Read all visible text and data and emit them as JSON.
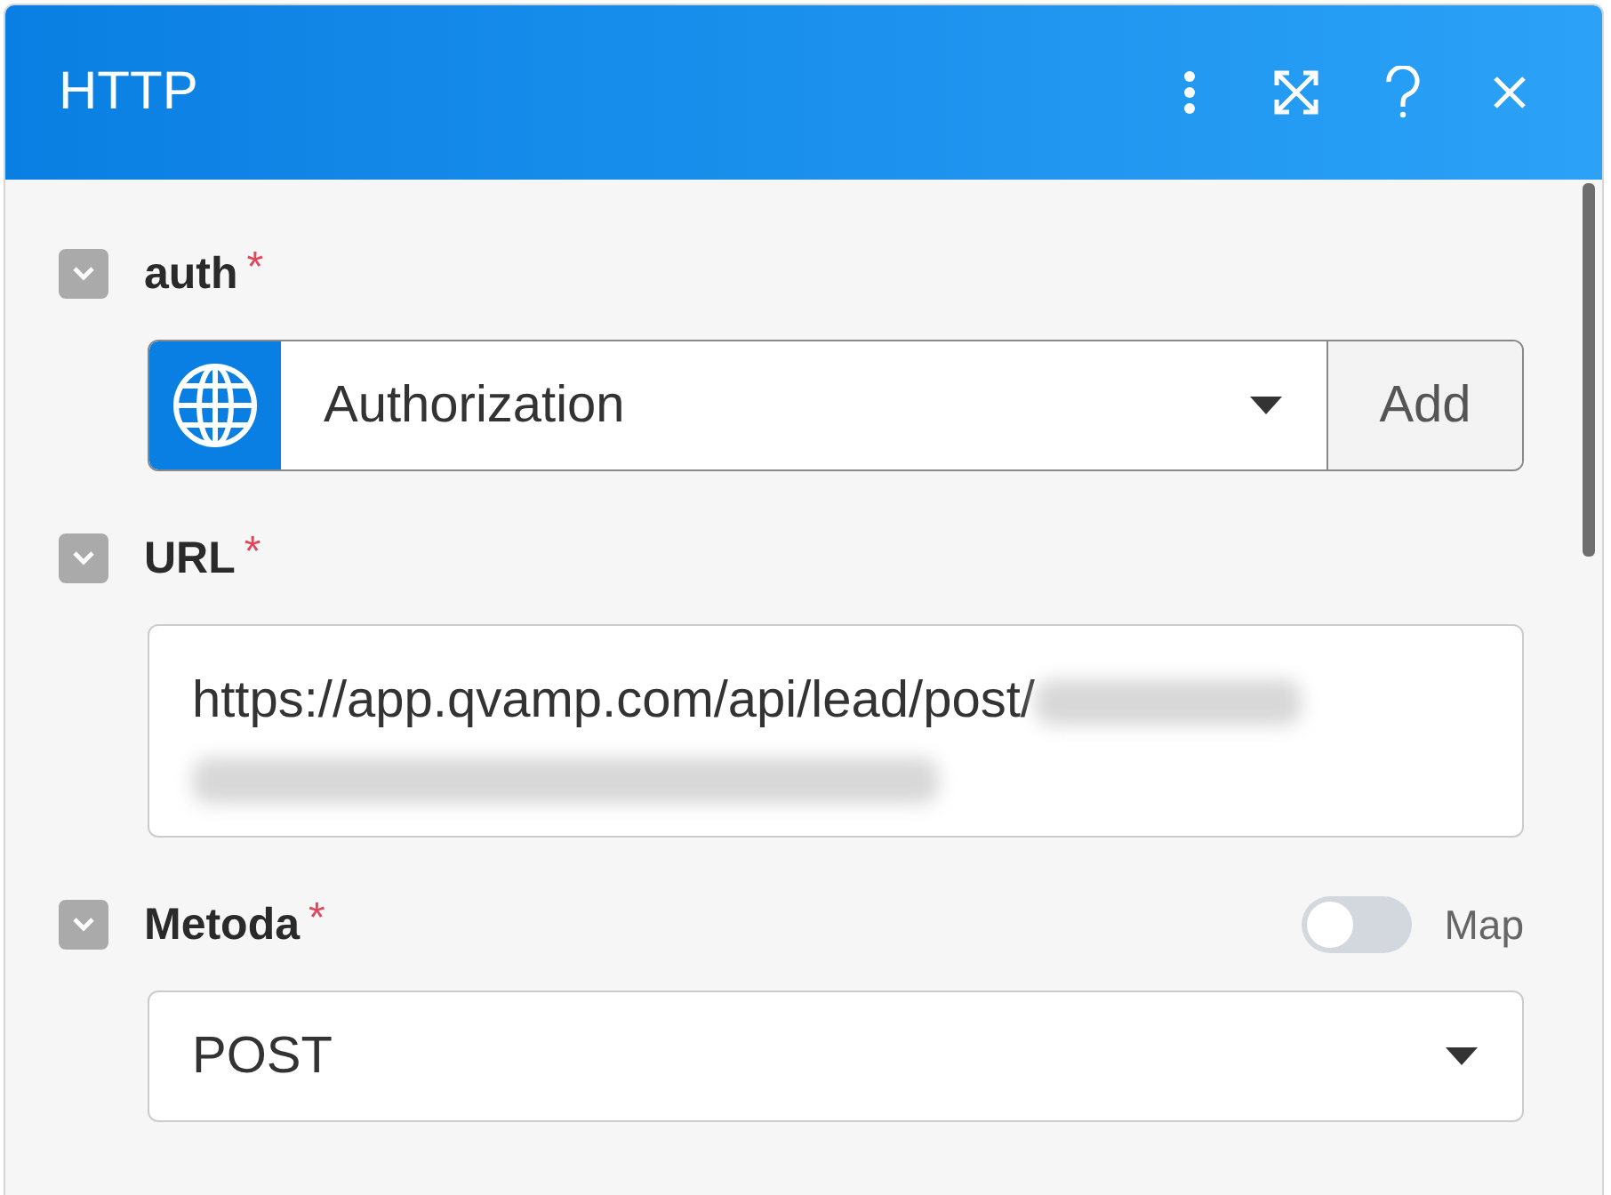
{
  "window": {
    "title": "HTTP"
  },
  "fields": [
    {
      "kind": "connection",
      "label": "auth",
      "required_mark": "*",
      "expanded": true,
      "value": "Authorization",
      "button": "Add"
    },
    {
      "kind": "textarea",
      "label": "URL",
      "required_mark": "*",
      "expanded": true,
      "value": "https://app.qvamp.com/api/lead/post/",
      "redacted": true
    },
    {
      "kind": "select",
      "label": "Metoda",
      "required_mark": "*",
      "expanded": true,
      "value": "POST",
      "map": {
        "label": "Map",
        "on": false
      }
    }
  ]
}
